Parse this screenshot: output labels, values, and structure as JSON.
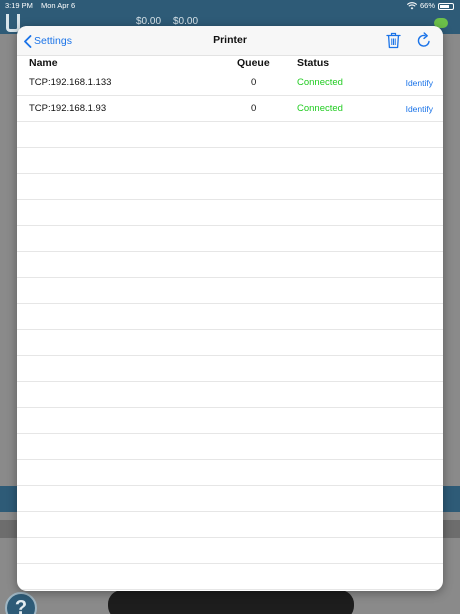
{
  "status_bar": {
    "time": "3:19 PM",
    "date": "Mon Apr 6",
    "battery": "66%"
  },
  "app_header": {
    "amount_1": "$0.00",
    "amount_2": "$0.00"
  },
  "modal": {
    "back_label": "Settings",
    "title": "Printer",
    "columns": {
      "name": "Name",
      "queue": "Queue",
      "status": "Status"
    },
    "printers": [
      {
        "name": "TCP:192.168.1.133",
        "queue": "0",
        "status": "Connected",
        "action": "Identify"
      },
      {
        "name": "TCP:192.168.1.93",
        "queue": "0",
        "status": "Connected",
        "action": "Identify"
      }
    ]
  },
  "help": {
    "label": "?"
  },
  "colors": {
    "accent": "#1a73e8",
    "connected": "#22cc22",
    "app_header": "#2e5b77"
  },
  "icons": [
    "chevron-left-icon",
    "trash-icon",
    "refresh-icon",
    "wifi-icon",
    "battery-icon",
    "help-icon"
  ]
}
